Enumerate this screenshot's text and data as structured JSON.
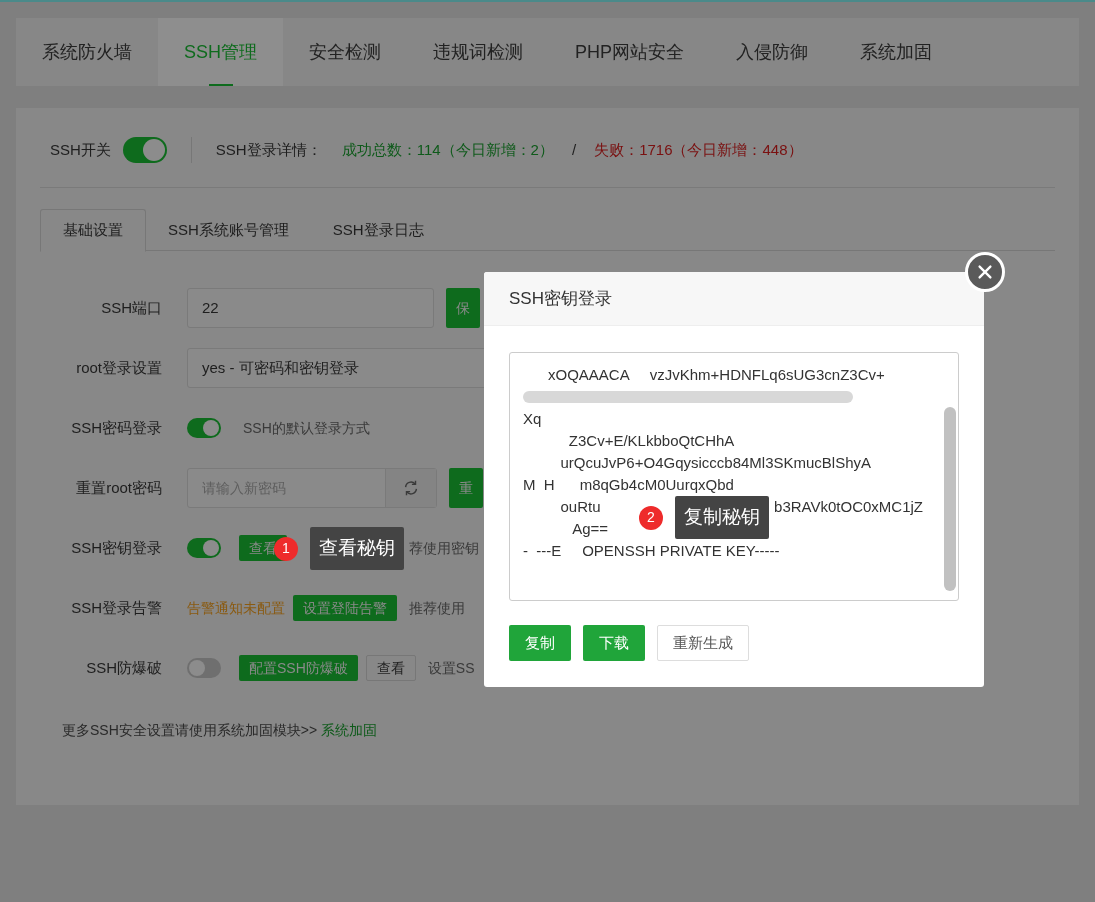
{
  "nav_tabs": [
    {
      "label": "系统防火墙",
      "selected": false
    },
    {
      "label": "SSH管理",
      "selected": true
    },
    {
      "label": "安全检测",
      "selected": false
    },
    {
      "label": "违规词检测",
      "selected": false
    },
    {
      "label": "PHP网站安全",
      "selected": false
    },
    {
      "label": "入侵防御",
      "selected": false
    },
    {
      "label": "系统加固",
      "selected": false
    }
  ],
  "status": {
    "switch_label": "SSH开关",
    "switch_on": true,
    "details_label": "SSH登录详情：",
    "success": "成功总数：114（今日新增：2）",
    "separator": "/",
    "failure": "失败：1716（今日新增：448）"
  },
  "sub_tabs": [
    {
      "label": "基础设置",
      "selected": true
    },
    {
      "label": "SSH系统账号管理",
      "selected": false
    },
    {
      "label": "SSH登录日志",
      "selected": false
    }
  ],
  "settings": [
    {
      "label": "SSH端口",
      "items": [
        {
          "kind": "input",
          "value": "22"
        },
        {
          "kind": "button",
          "label": "保"
        }
      ]
    },
    {
      "label": "root登录设置",
      "items": [
        {
          "kind": "select",
          "value": "yes - 可密码和密钥登录"
        }
      ]
    },
    {
      "label": "SSH密码登录",
      "items": [
        {
          "kind": "toggle",
          "on": true
        },
        {
          "kind": "hint",
          "text": "SSH的默认登录方式"
        }
      ]
    },
    {
      "label": "重置root密码",
      "items": [
        {
          "kind": "password",
          "placeholder": "请输入新密码"
        },
        {
          "kind": "button",
          "label": "重"
        }
      ]
    },
    {
      "label": "SSH密钥登录",
      "items": [
        {
          "kind": "toggle",
          "on": true
        },
        {
          "kind": "button",
          "label": "查看"
        },
        {
          "kind": "hint",
          "text": "荐使用密钥"
        }
      ]
    },
    {
      "label": "SSH登录告警",
      "items": [
        {
          "kind": "warning",
          "text": "告警通知未配置"
        },
        {
          "kind": "button",
          "label": "设置登陆告警"
        },
        {
          "kind": "hint",
          "text": "推荐使用"
        }
      ]
    },
    {
      "label": "SSH防爆破",
      "items": [
        {
          "kind": "toggle",
          "on": false
        },
        {
          "kind": "button",
          "label": "配置SSH防爆破"
        },
        {
          "kind": "plain_button",
          "label": "查看"
        },
        {
          "kind": "hint",
          "text": "设置SS"
        }
      ]
    }
  ],
  "footer": {
    "text": "更多SSH安全设置请使用系统加固模块>> ",
    "link": "系统加固"
  },
  "dialog": {
    "title": "SSH密钥登录",
    "key_lines": [
      {
        "kind": "text",
        "text": "      xOQAAACA     vzJvKhm+HDNFLq6sUG3cnZ3Cv+"
      },
      {
        "kind": "redacted"
      },
      {
        "kind": "text",
        "text": "Xq"
      },
      {
        "kind": "text",
        "text": "           Z3Cv+E/KLkbboQtCHhA"
      },
      {
        "kind": "text",
        "text": "         urQcuJvP6+O4Gqysicccb84Ml3SKmucBlShyA"
      },
      {
        "kind": "text",
        "text": "M  H      m8qGb4cM0UurqxQbd"
      },
      {
        "kind": "split",
        "parts": [
          "         ouRtu",
          "b3RAVk0tOC0xMC1jZ"
        ]
      },
      {
        "kind": "text",
        "text": "            Ag=="
      },
      {
        "kind": "text",
        "text": "-  ---E     OPENSSH PRIVATE KEY-----"
      }
    ],
    "buttons": [
      {
        "kind": "button",
        "label": "复制"
      },
      {
        "kind": "button",
        "label": "下载"
      },
      {
        "kind": "plain_button",
        "label": "重新生成"
      }
    ]
  },
  "annotations": [
    {
      "number": "1",
      "text": "查看秘钥"
    },
    {
      "number": "2",
      "text": "复制秘钥"
    }
  ]
}
